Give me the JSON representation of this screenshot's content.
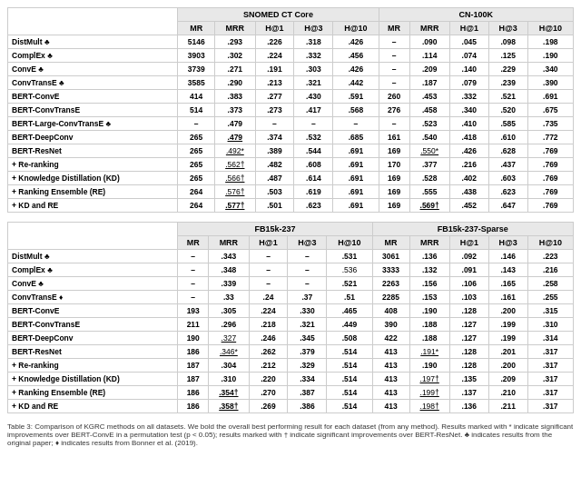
{
  "tables": [
    {
      "id": "snomed-cn",
      "sections": [
        {
          "header": [
            "",
            "SNOMED CT Core",
            "",
            "",
            "",
            "",
            "CN-100K",
            "",
            "",
            "",
            ""
          ],
          "subheader": [
            "",
            "MR",
            "MRR",
            "H@1",
            "H@3",
            "H@10",
            "MR",
            "MRR",
            "H@1",
            "H@3",
            "H@10"
          ]
        },
        {
          "group": "baseline",
          "rows": [
            [
              "DistMult ♣",
              "5146",
              ".293",
              ".226",
              ".318",
              ".426",
              "–",
              ".090",
              ".045",
              ".098",
              ".198"
            ],
            [
              "ComplEx ♣",
              "3903",
              ".302",
              ".224",
              ".332",
              ".456",
              "–",
              ".114",
              ".074",
              ".125",
              ".190"
            ],
            [
              "ConvE ♣",
              "3739",
              ".271",
              ".191",
              ".303",
              ".426",
              "–",
              ".209",
              ".140",
              ".229",
              ".340"
            ],
            [
              "ConvTransE ♣",
              "3585",
              ".290",
              ".213",
              ".321",
              ".442",
              "–",
              ".187",
              ".079",
              ".239",
              ".390"
            ]
          ]
        },
        {
          "group": "bert-conve",
          "rows": [
            [
              "BERT-ConvE",
              "414",
              ".383",
              ".277",
              ".430",
              ".591",
              "260",
              ".453",
              ".332",
              ".521",
              ".691"
            ],
            [
              "BERT-ConvTransE",
              "514",
              ".373",
              ".273",
              ".417",
              ".568",
              "276",
              ".458",
              ".340",
              ".520",
              ".675"
            ],
            [
              "BERT-Large-ConvTransE ♣",
              "–",
              ".479",
              "–",
              "–",
              "–",
              "–",
              ".523",
              ".410",
              ".585",
              ".735"
            ]
          ]
        },
        {
          "group": "bert-deepconv",
          "rows": [
            [
              "BERT-DeepConv",
              "265",
              ".479",
              ".374",
              ".532",
              ".685",
              "161",
              ".540",
              ".418",
              ".610",
              ".772"
            ]
          ],
          "bold_cols": [
            1,
            2,
            3,
            4,
            5,
            6,
            7,
            8,
            9,
            10
          ]
        },
        {
          "group": "bert-resnet",
          "rows": [
            [
              "BERT-ResNet",
              "265",
              ".492*",
              ".389",
              ".544",
              ".691",
              "169",
              ".550*",
              ".426",
              ".628",
              ".769"
            ],
            [
              "+ Re-ranking",
              "265",
              ".562†",
              ".482",
              ".608",
              ".691",
              "170",
              ".377",
              ".216",
              ".437",
              ".769"
            ],
            [
              "+ Knowledge Distillation (KD)",
              "265",
              ".566†",
              ".487",
              ".614",
              ".691",
              "169",
              ".528",
              ".402",
              ".603",
              ".769"
            ],
            [
              "+ Ranking Ensemble (RE)",
              "264",
              ".576†",
              ".503",
              ".619",
              ".691",
              "169",
              ".555",
              ".438",
              ".623",
              ".769"
            ],
            [
              "+ KD and RE",
              "264",
              ".577†",
              ".501",
              ".623",
              ".691",
              "169",
              ".569†",
              ".452",
              ".647",
              ".769"
            ]
          ]
        }
      ]
    },
    {
      "id": "fb15k",
      "sections": [
        {
          "header": [
            "",
            "FB15k-237",
            "",
            "",
            "",
            "",
            "FB15k-237-Sparse",
            "",
            "",
            "",
            ""
          ],
          "subheader": [
            "",
            "MR",
            "MRR",
            "H@1",
            "H@3",
            "H@10",
            "MR",
            "MRR",
            "H@1",
            "H@3",
            "H@10"
          ]
        },
        {
          "group": "baseline",
          "rows": [
            [
              "DistMult ♣",
              "–",
              ".343",
              "–",
              "–",
              ".531",
              "3061",
              ".136",
              ".092",
              ".146",
              ".223"
            ],
            [
              "ComplEx ♣",
              "–",
              ".348",
              "–",
              "–",
              ".536",
              "3333",
              ".132",
              ".091",
              ".143",
              ".216"
            ],
            [
              "ConvE ♣",
              "–",
              ".339",
              "–",
              "–",
              ".521",
              "2263",
              ".156",
              ".106",
              ".165",
              ".258"
            ],
            [
              "ConvTransE ♦",
              "–",
              ".33",
              ".24",
              ".37",
              ".51",
              "2285",
              ".153",
              ".103",
              ".161",
              ".255"
            ]
          ]
        },
        {
          "group": "bert-conve",
          "rows": [
            [
              "BERT-ConvE",
              "193",
              ".305",
              ".224",
              ".330",
              ".465",
              "408",
              ".190",
              ".128",
              ".200",
              ".315"
            ],
            [
              "BERT-ConvTransE",
              "211",
              ".296",
              ".218",
              ".321",
              ".449",
              "390",
              ".188",
              ".127",
              ".199",
              ".310"
            ]
          ]
        },
        {
          "group": "bert-deepconv",
          "rows": [
            [
              "BERT-DeepConv",
              "190",
              ".327",
              ".246",
              ".345",
              ".508",
              "422",
              ".188",
              ".127",
              ".199",
              ".314"
            ]
          ]
        },
        {
          "group": "bert-resnet",
          "rows": [
            [
              "BERT-ResNet",
              "186",
              ".346*",
              ".262",
              ".379",
              ".514",
              "413",
              ".191*",
              ".128",
              ".201",
              ".317"
            ],
            [
              "+ Re-ranking",
              "187",
              ".304",
              ".212",
              ".329",
              ".514",
              "413",
              ".190",
              ".128",
              ".200",
              ".317"
            ],
            [
              "+ Knowledge Distillation (KD)",
              "187",
              ".310",
              ".220",
              ".334",
              ".514",
              "413",
              ".197†",
              ".135",
              ".209",
              ".317"
            ],
            [
              "+ Ranking Ensemble (RE)",
              "186",
              ".354†",
              ".270",
              ".387",
              ".514",
              "413",
              ".199†",
              ".137",
              ".210",
              ".317"
            ],
            [
              "+ KD and RE",
              "186",
              ".358†",
              ".269",
              ".386",
              ".514",
              "413",
              ".198†",
              ".136",
              ".211",
              ".317"
            ]
          ]
        }
      ]
    }
  ],
  "caption": "Table 3: Comparison of KGRC methods on all datasets. We bold the overall best performing result for each dataset (from any method). Results marked with * indicate significant improvements over BERT-ConvE in a permutation test (p < 0.05); results marked with † indicate significant improvements over BERT-ResNet. ♣ indicates results from the original paper; ♦ indicates results from Bonner et al. (2019)."
}
